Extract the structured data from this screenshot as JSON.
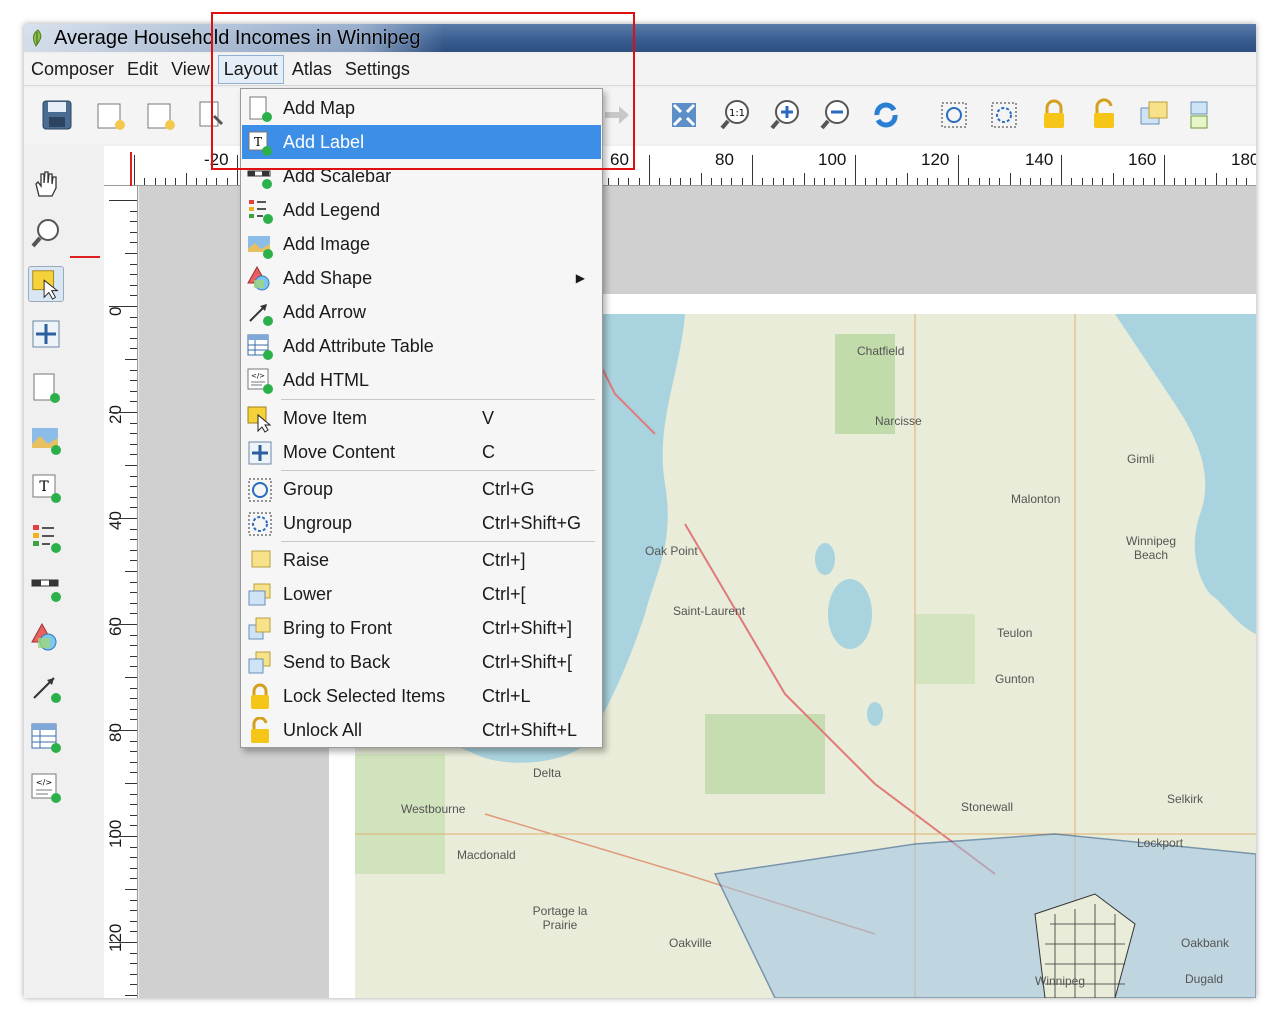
{
  "window": {
    "title": "Average Household Incomes in Winnipeg"
  },
  "menubar": {
    "items": [
      "Composer",
      "Edit",
      "View",
      "Layout",
      "Atlas",
      "Settings"
    ],
    "active": "Layout"
  },
  "layout_menu": {
    "items": [
      {
        "label": "Add Map",
        "shortcut": "",
        "icon": "add-map-icon"
      },
      {
        "label": "Add Label",
        "shortcut": "",
        "icon": "add-label-icon",
        "highlighted": true
      },
      {
        "label": "Add Scalebar",
        "shortcut": "",
        "icon": "add-scalebar-icon"
      },
      {
        "label": "Add Legend",
        "shortcut": "",
        "icon": "add-legend-icon"
      },
      {
        "label": "Add Image",
        "shortcut": "",
        "icon": "add-image-icon"
      },
      {
        "label": "Add Shape",
        "shortcut": "",
        "icon": "add-shape-icon",
        "submenu": true
      },
      {
        "label": "Add Arrow",
        "shortcut": "",
        "icon": "add-arrow-icon"
      },
      {
        "label": "Add Attribute Table",
        "shortcut": "",
        "icon": "add-attribute-table-icon"
      },
      {
        "label": "Add HTML",
        "shortcut": "",
        "icon": "add-html-icon"
      },
      {
        "label": "Move Item",
        "shortcut": "V",
        "icon": "move-item-icon"
      },
      {
        "label": "Move Content",
        "shortcut": "C",
        "icon": "move-content-icon"
      },
      {
        "label": "Group",
        "shortcut": "Ctrl+G",
        "icon": "group-icon"
      },
      {
        "label": "Ungroup",
        "shortcut": "Ctrl+Shift+G",
        "icon": "ungroup-icon"
      },
      {
        "label": "Raise",
        "shortcut": "Ctrl+]",
        "icon": "raise-icon"
      },
      {
        "label": "Lower",
        "shortcut": "Ctrl+[",
        "icon": "lower-icon"
      },
      {
        "label": "Bring to Front",
        "shortcut": "Ctrl+Shift+]",
        "icon": "bring-to-front-icon"
      },
      {
        "label": "Send to Back",
        "shortcut": "Ctrl+Shift+[",
        "icon": "send-to-back-icon"
      },
      {
        "label": "Lock Selected Items",
        "shortcut": "Ctrl+L",
        "icon": "lock-icon"
      },
      {
        "label": "Unlock All",
        "shortcut": "Ctrl+Shift+L",
        "icon": "unlock-icon"
      }
    ]
  },
  "hruler": {
    "labels": [
      "-20",
      "60",
      "80",
      "100",
      "120",
      "140",
      "160",
      "180"
    ]
  },
  "vruler": {
    "labels": [
      "0",
      "20",
      "40",
      "60",
      "80",
      "100",
      "120"
    ]
  },
  "map_labels": [
    "Chatfield",
    "Narcisse",
    "Gimli",
    "Malonton",
    "Winnipeg Beach",
    "Oak Point",
    "Saint-Laurent",
    "Teulon",
    "Gunton",
    "Delta",
    "Westbourne",
    "Selkirk",
    "Macdonald",
    "Lockport",
    "Stonewall",
    "Portage la Prairie",
    "Oakville",
    "Oakbank",
    "Dugald",
    "Winnipeg"
  ],
  "colors": {
    "highlight": "#3d8ee6",
    "annotation_box": "#e01010",
    "lake": "#a9d3df",
    "city_area": "#9ec3e6"
  }
}
